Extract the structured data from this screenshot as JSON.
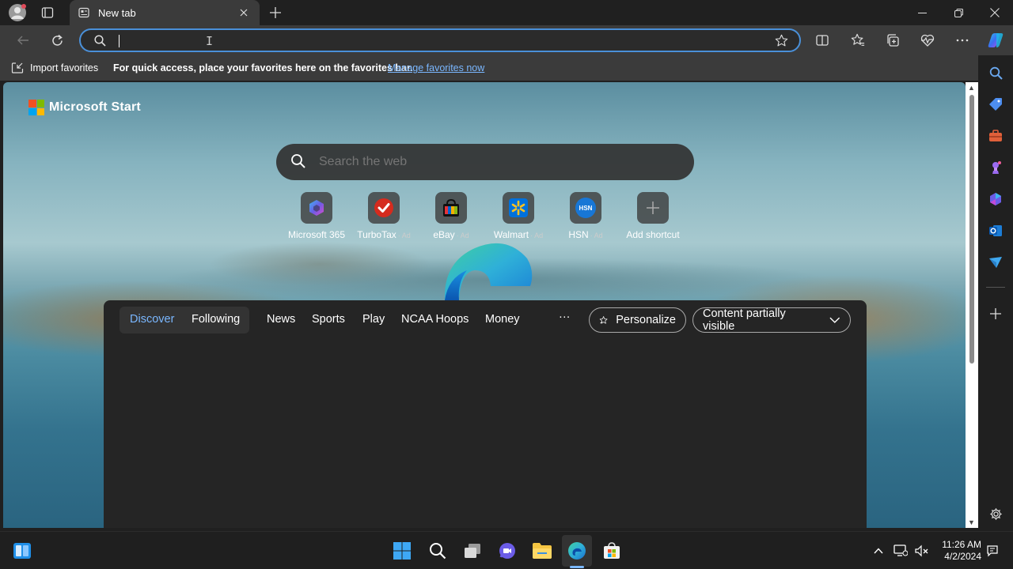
{
  "tab": {
    "title": "New tab"
  },
  "addressbar": {
    "value": "",
    "placeholder": ""
  },
  "favorites_bar": {
    "import_label": "Import favorites",
    "message": "For quick access, place your favorites here on the favorites bar.",
    "manage_link": "Manage favorites now"
  },
  "page": {
    "brand": "Microsoft Start",
    "search_placeholder": "Search the web",
    "shortcuts": [
      {
        "label": "Microsoft 365",
        "ad": "",
        "icon": "microsoft-365-icon"
      },
      {
        "label": "TurboTax",
        "ad": "Ad",
        "icon": "turbotax-icon"
      },
      {
        "label": "eBay",
        "ad": "Ad",
        "icon": "ebay-icon"
      },
      {
        "label": "Walmart",
        "ad": "Ad",
        "icon": "walmart-icon"
      },
      {
        "label": "HSN",
        "ad": "Ad",
        "icon": "hsn-icon",
        "icon_text": "HSN"
      },
      {
        "label": "Add shortcut",
        "ad": "",
        "icon": "plus-icon"
      }
    ]
  },
  "feed": {
    "tabs": [
      "Discover",
      "Following",
      "News",
      "Sports",
      "Play",
      "NCAA Hoops",
      "Money"
    ],
    "more": "···",
    "personalize_label": "Personalize",
    "visibility_label": "Content partially visible"
  },
  "taskbar": {
    "time": "11:26 AM",
    "date": "4/2/2024"
  },
  "colors": {
    "accent": "#7ab7ff",
    "focus_border": "#4a90d9",
    "feed_bg": "#252525"
  }
}
